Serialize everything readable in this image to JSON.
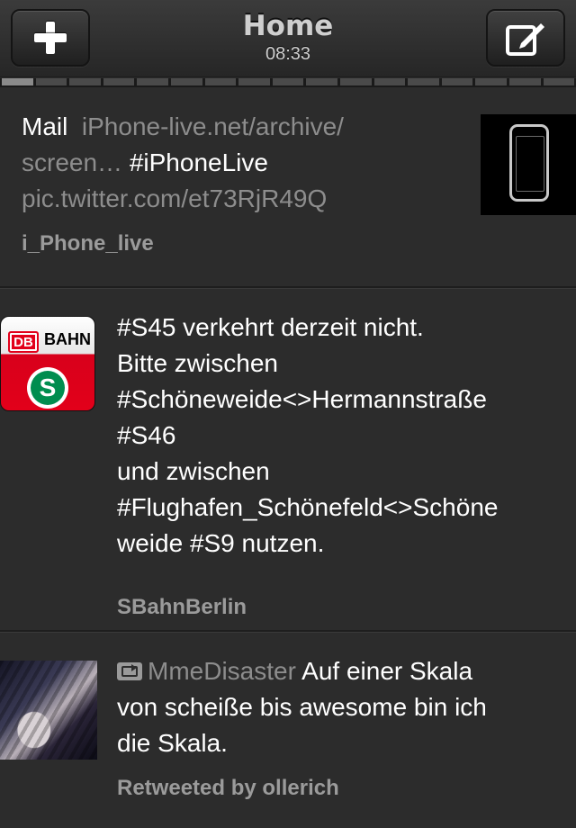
{
  "header": {
    "title": "Home",
    "time": "08:33",
    "add_icon": "plus-icon",
    "compose_icon": "compose-icon"
  },
  "pager": {
    "segments": 17,
    "active_index": 0
  },
  "tweets": [
    {
      "lead": "Mail",
      "link1": "iPhone-live.net/archive/",
      "link1b": "screen…",
      "hashtag": "#iPhoneLive",
      "link2": "pic.twitter.com/et73RjR49Q",
      "author": "i_Phone_live",
      "thumbnail_icon": "phone-icon"
    },
    {
      "lines": [
        "#S45 verkehrt derzeit nicht.",
        "Bitte zwischen",
        "#Schöneweide<>Hermannstraße",
        "#S46",
        "und zwischen",
        "#Flughafen_Schönefeld<>Schöne",
        "weide #S9 nutzen."
      ],
      "author": "SBahnBerlin",
      "avatar": {
        "db": "DB",
        "bahn": "BAHN",
        "s": "S"
      }
    },
    {
      "rt_user": "MmeDisaster",
      "text_after_user": " Auf einer Skala",
      "lines": [
        "von scheiße bis awesome bin ich",
        "die Skala."
      ],
      "author": "Retweeted by ollerich"
    }
  ],
  "colors": {
    "background": "#2c2c2c",
    "link_gray": "#8d8d8d",
    "author_gray": "#9b9b9b",
    "db_red": "#e2001a",
    "sbahn_green": "#008d4f"
  }
}
